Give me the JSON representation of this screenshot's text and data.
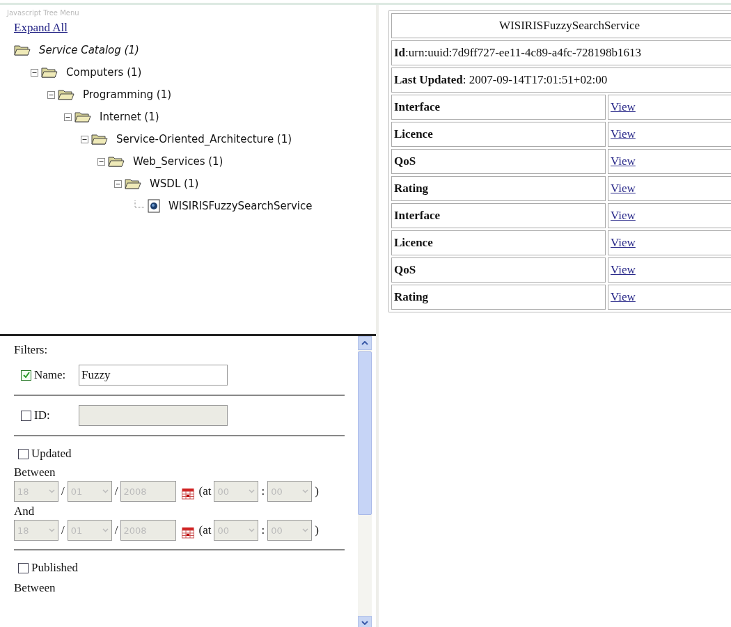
{
  "tree_panel": {
    "title": "Javascript Tree Menu",
    "expand_all": "Expand All",
    "tree": [
      {
        "label": "Service Catalog (1)",
        "kind": "root",
        "children": [
          {
            "label": "Computers (1)",
            "kind": "folder",
            "expanded": true,
            "children": [
              {
                "label": "Programming (1)",
                "kind": "folder",
                "expanded": true,
                "children": [
                  {
                    "label": "Internet (1)",
                    "kind": "folder",
                    "expanded": true,
                    "children": [
                      {
                        "label": "Service-Oriented_Architecture (1)",
                        "kind": "folder",
                        "expanded": true,
                        "children": [
                          {
                            "label": "Web_Services (1)",
                            "kind": "folder",
                            "expanded": true,
                            "children": [
                              {
                                "label": "WSDL (1)",
                                "kind": "folder",
                                "expanded": true,
                                "children": [
                                  {
                                    "label": "WISIRISFuzzySearchService",
                                    "kind": "service"
                                  }
                                ]
                              }
                            ]
                          }
                        ]
                      }
                    ]
                  }
                ]
              }
            ]
          }
        ]
      }
    ]
  },
  "filters": {
    "heading": "Filters:",
    "name": {
      "label": "Name:",
      "checked": true,
      "value": "Fuzzy",
      "disabled": false
    },
    "id": {
      "label": "ID:",
      "checked": false,
      "disabled": true
    },
    "updated": {
      "label": "Updated",
      "checked": false,
      "disabled": true,
      "ranges": [
        {
          "label": "Between",
          "parts": [
            {
              "kind": "select",
              "value": "18"
            },
            {
              "kind": "text",
              "text": "/"
            },
            {
              "kind": "select",
              "value": "01"
            },
            {
              "kind": "text",
              "text": "/"
            },
            {
              "kind": "input",
              "value": "2008"
            },
            {
              "kind": "calendar"
            },
            {
              "kind": "text",
              "text": "(at"
            },
            {
              "kind": "select",
              "value": "00"
            },
            {
              "kind": "text",
              "text": ":"
            },
            {
              "kind": "select",
              "value": "00"
            },
            {
              "kind": "text",
              "text": ")"
            }
          ]
        },
        {
          "label": "And",
          "parts": [
            {
              "kind": "select",
              "value": "18"
            },
            {
              "kind": "text",
              "text": "/"
            },
            {
              "kind": "select",
              "value": "01"
            },
            {
              "kind": "text",
              "text": "/"
            },
            {
              "kind": "input",
              "value": "2008"
            },
            {
              "kind": "calendar"
            },
            {
              "kind": "text",
              "text": "(at"
            },
            {
              "kind": "select",
              "value": "00"
            },
            {
              "kind": "text",
              "text": ":"
            },
            {
              "kind": "select",
              "value": "00"
            },
            {
              "kind": "text",
              "text": ")"
            }
          ]
        }
      ]
    },
    "published": {
      "label": "Published",
      "checked": false,
      "next": "Between"
    }
  },
  "details": {
    "title": "WISIRISFuzzySearchService",
    "id_line": "**Id**:urn:uuid:7d9ff727-ee11-4c89-a4fc-728198b1613",
    "last_updated": "**Last Updated**: 2007-09-14T17:01:51+02:00",
    "rows": [
      {
        "label": "Interface",
        "link": "View"
      },
      {
        "label": "Licence",
        "link": "View"
      },
      {
        "label": "QoS",
        "link": "View"
      },
      {
        "label": "Rating",
        "link": "View"
      },
      {
        "label": "Interface",
        "link": "View"
      },
      {
        "label": "Licence",
        "link": "View"
      },
      {
        "label": "QoS",
        "link": "View"
      },
      {
        "label": "Rating",
        "link": "View"
      }
    ]
  }
}
